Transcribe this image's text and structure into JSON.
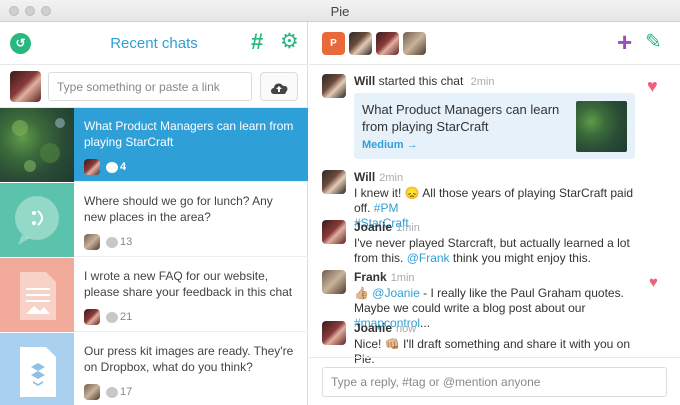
{
  "window": {
    "title": "Pie"
  },
  "left": {
    "title": "Recent chats",
    "compose_placeholder": "Type something or paste a link",
    "chats": [
      {
        "text": "What Product Managers can learn from playing StarCraft",
        "count": "4"
      },
      {
        "text": "Where should we go for lunch? Any new places in the area?",
        "count": "13"
      },
      {
        "text": "I wrote a new FAQ for our website, please share your feedback in this chat",
        "count": "21"
      },
      {
        "text": "Our press kit images are ready. They're on Dropbox, what do you think?",
        "count": "17"
      }
    ]
  },
  "right": {
    "starter": {
      "name": "Will",
      "action": "started this chat",
      "time": "2min"
    },
    "link_card": {
      "title": "What Product Managers can learn from playing StarCraft",
      "source": "Medium →"
    },
    "messages": [
      {
        "name": "Will",
        "time": "2min",
        "pre": "I knew it! 😞 All those years of playing StarCraft paid off. ",
        "tag": "#PM",
        "tag2": "#StarCraft"
      },
      {
        "name": "Joanie",
        "time": "1min",
        "pre": "I've never played Starcraft, but actually learned a lot from this. ",
        "mention": "@Frank",
        "post": " think you might enjoy this."
      },
      {
        "name": "Frank",
        "time": "1min",
        "emoji": "👍🏼 ",
        "mention": "@Joanie",
        "pre": " - I really like the Paul Graham quotes. Maybe we could write a blog post about our ",
        "tag": "#mapcontrol",
        "post": "..."
      },
      {
        "name": "Joanie",
        "time": "now",
        "pre": "Nice! 👊🏼 I'll draft something and share it with you on Pie."
      }
    ],
    "reply_placeholder": "Type a reply, #tag or @mention anyone"
  },
  "colors": {
    "accent_blue": "#2f9fd8",
    "accent_green": "#27b77f",
    "heart": "#f0607a",
    "plus_purple": "#9a4dbf"
  },
  "icons": [
    "back-icon",
    "hashtag-icon",
    "gear-icon",
    "cloud-upload-icon",
    "comment-bubble-icon",
    "plus-icon",
    "pencil-icon",
    "heart-icon",
    "powerpoint-icon"
  ]
}
